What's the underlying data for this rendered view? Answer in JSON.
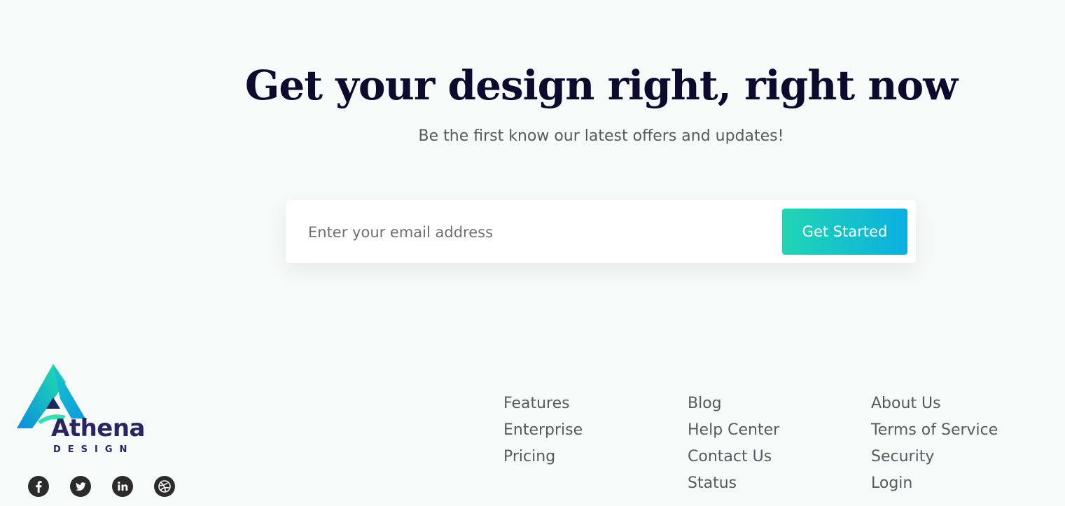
{
  "hero": {
    "headline": "Get your design right, right now",
    "subheadline": "Be the first know our latest offers and updates!"
  },
  "signup": {
    "email_placeholder": "Enter your email address",
    "email_value": "",
    "button_label": "Get Started"
  },
  "brand": {
    "name": "Athena",
    "tagline": "DESIGN",
    "colors": {
      "gradient_start": "#1fd6b4",
      "gradient_end": "#0ab0e0",
      "navy": "#2a2460"
    }
  },
  "social": [
    {
      "icon": "facebook-icon"
    },
    {
      "icon": "twitter-icon"
    },
    {
      "icon": "linkedin-icon"
    },
    {
      "icon": "dribbble-icon"
    }
  ],
  "footer": {
    "columns": [
      {
        "links": [
          "Features",
          "Enterprise",
          "Pricing"
        ]
      },
      {
        "links": [
          "Blog",
          "Help Center",
          "Contact Us",
          "Status"
        ]
      },
      {
        "links": [
          "About Us",
          "Terms of Service",
          "Security",
          "Login"
        ]
      }
    ]
  }
}
